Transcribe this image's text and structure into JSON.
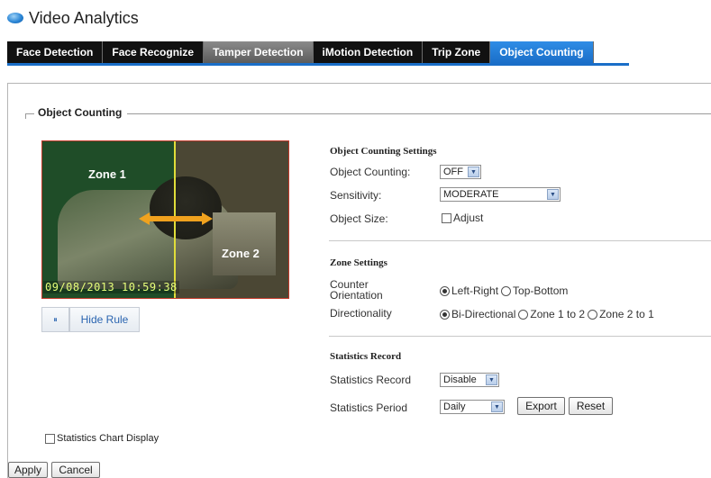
{
  "app": {
    "title": "Video Analytics"
  },
  "tabs": [
    {
      "label": "Face Detection"
    },
    {
      "label": "Face Recognize"
    },
    {
      "label": "Tamper Detection"
    },
    {
      "label": "iMotion Detection"
    },
    {
      "label": "Trip Zone"
    },
    {
      "label": "Object Counting"
    }
  ],
  "section": {
    "legend": "Object Counting"
  },
  "video": {
    "zone1_label": "Zone 1",
    "zone2_label": "Zone 2",
    "timestamp": "09/08/2013  10:59:38"
  },
  "controls": {
    "pause_icon": "⏸",
    "hide_rule": "Hide Rule"
  },
  "object_counting_settings": {
    "title": "Object Counting Settings",
    "object_counting_label": "Object Counting:",
    "object_counting_value": "OFF",
    "sensitivity_label": "Sensitivity:",
    "sensitivity_value": "MODERATE",
    "object_size_label": "Object Size:",
    "adjust_label": "Adjust"
  },
  "zone_settings": {
    "title": "Zone Settings",
    "counter_orientation_label_1": "Counter",
    "counter_orientation_label_2": "Orientation",
    "orientation_options": [
      "Left-Right",
      "Top-Bottom"
    ],
    "directionality_label": "Directionality",
    "direction_options": [
      "Bi-Directional",
      "Zone 1 to 2",
      "Zone 2 to 1"
    ]
  },
  "statistics": {
    "title": "Statistics Record",
    "record_label": "Statistics Record",
    "record_value": "Disable",
    "period_label": "Statistics Period",
    "period_value": "Daily",
    "export_label": "Export",
    "reset_label": "Reset"
  },
  "chart_display_label": "Statistics Chart Display",
  "footer": {
    "apply_label": "Apply",
    "cancel_label": "Cancel"
  },
  "colors": {
    "active_tab": "#1a6ec8",
    "tab_bg": "#111111",
    "grey_tab": "#6e6e6e",
    "arrow": "#f0a21e"
  }
}
